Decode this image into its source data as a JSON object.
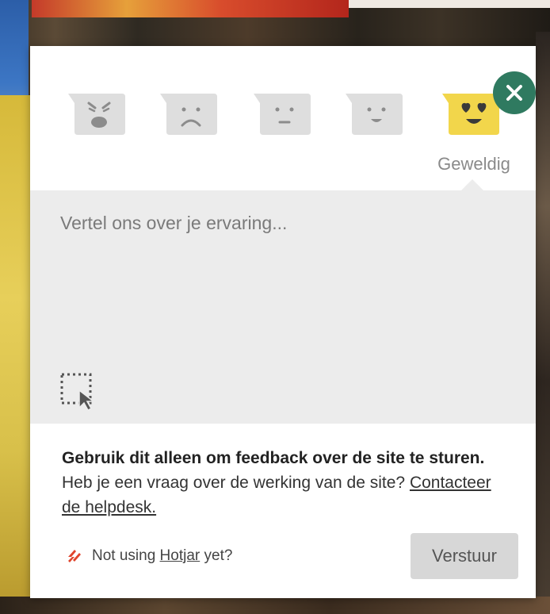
{
  "widget": {
    "selected_emotion_label": "Geweldig",
    "placeholder": "Vertel ons over je ervaring...",
    "info_bold": "Gebruik dit alleen om feedback over de site te sturen.",
    "info_text": " Heb je een vraag over de werking van de site? ",
    "info_link": "Contacteer de helpdesk.",
    "hotjar_prefix": "Not using ",
    "hotjar_link": "Hotjar",
    "hotjar_suffix": " yet?",
    "submit_label": "Verstuur"
  },
  "emotions": [
    {
      "icon": "angry-face-icon",
      "selected": false
    },
    {
      "icon": "sad-face-icon",
      "selected": false
    },
    {
      "icon": "neutral-face-icon",
      "selected": false
    },
    {
      "icon": "happy-face-icon",
      "selected": false
    },
    {
      "icon": "love-face-icon",
      "selected": true
    }
  ],
  "colors": {
    "close_button": "#2f7a60",
    "emotion_inactive": "#dedede",
    "emotion_selected": "#f2d64b",
    "feedback_area": "#ececec",
    "submit_button": "#d7d7d7",
    "hotjar_accent": "#e0442c"
  }
}
